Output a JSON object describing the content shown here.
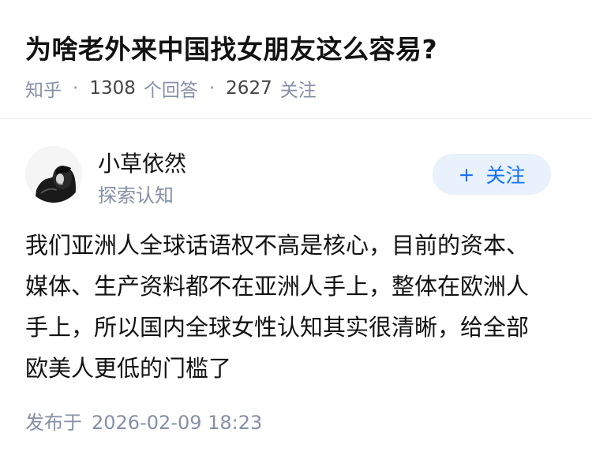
{
  "question": {
    "title": "为啥老外来中国找女朋友这么容易?",
    "source": "知乎",
    "separator": "·",
    "answer_count": "1308",
    "answer_label": "个回答",
    "follower_count": "2627",
    "follower_label": "关注"
  },
  "author": {
    "name": "小草依然",
    "headline": "探索认知",
    "avatar_icon": "portrait-avatar"
  },
  "follow_button": {
    "icon": "+",
    "label": "关注",
    "bg_color": "#e8f1fc",
    "text_color": "#1772f6"
  },
  "answer": {
    "lines": [
      "我们亚洲人全球话语权不高是核心，目前的资本、",
      "媒体、生产资料都不在亚洲人手上，整体在欧洲人",
      "手上，所以国内全球女性认知其实很清晰，给全部",
      "欧美人更低的门槛了"
    ]
  },
  "publish": {
    "label": "发布于",
    "time": "2026-02-09 18:23"
  }
}
